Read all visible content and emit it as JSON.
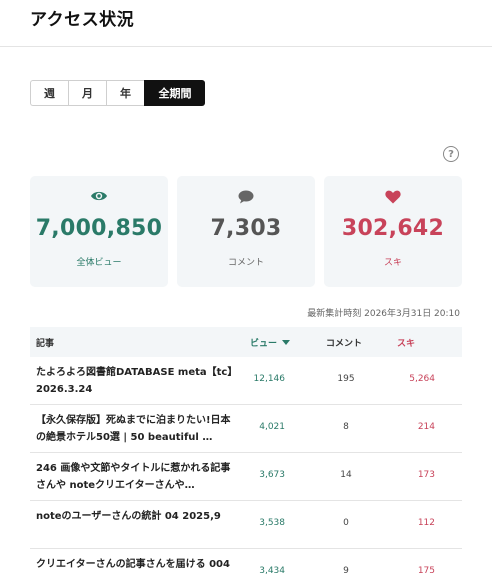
{
  "page_title": "アクセス状況",
  "period_tabs": [
    {
      "label": "週",
      "active": false
    },
    {
      "label": "月",
      "active": false
    },
    {
      "label": "年",
      "active": false
    },
    {
      "label": "全期間",
      "active": true
    }
  ],
  "help_icon": "?",
  "stats": {
    "views": {
      "value": "7,000,850",
      "label": "全体ビュー",
      "icon": "eye-icon",
      "color": "#2a7a68"
    },
    "comments": {
      "value": "7,303",
      "label": "コメント",
      "icon": "speech-bubble-icon",
      "color": "#555555"
    },
    "likes": {
      "value": "302,642",
      "label": "スキ",
      "icon": "heart-icon",
      "color": "#c8435a"
    }
  },
  "updated_at": "最新集計時刻 2026年3月31日 20:10",
  "table": {
    "headers": {
      "article": "記事",
      "views": "ビュー",
      "comments": "コメント",
      "likes": "スキ"
    },
    "rows": [
      {
        "title": "たよろよろ図書館DATABASE meta【tc】2026.3.24",
        "views": "12,146",
        "comments": "195",
        "likes": "5,264"
      },
      {
        "title": "【永久保存版】死ぬまでに泊まりたい!日本の絶景ホテル50選 | 50 beautiful …",
        "views": "4,021",
        "comments": "8",
        "likes": "214"
      },
      {
        "title": "246 画像や文節やタイトルに惹かれる記事さんや noteクリエイターさんや…",
        "views": "3,673",
        "comments": "14",
        "likes": "173"
      },
      {
        "title": "noteのユーザーさんの統計 04 2025,9",
        "views": "3,538",
        "comments": "0",
        "likes": "112"
      },
      {
        "title": "クリエイターさんの記事さんを届ける 004",
        "views": "3,434",
        "comments": "9",
        "likes": "175"
      }
    ]
  }
}
